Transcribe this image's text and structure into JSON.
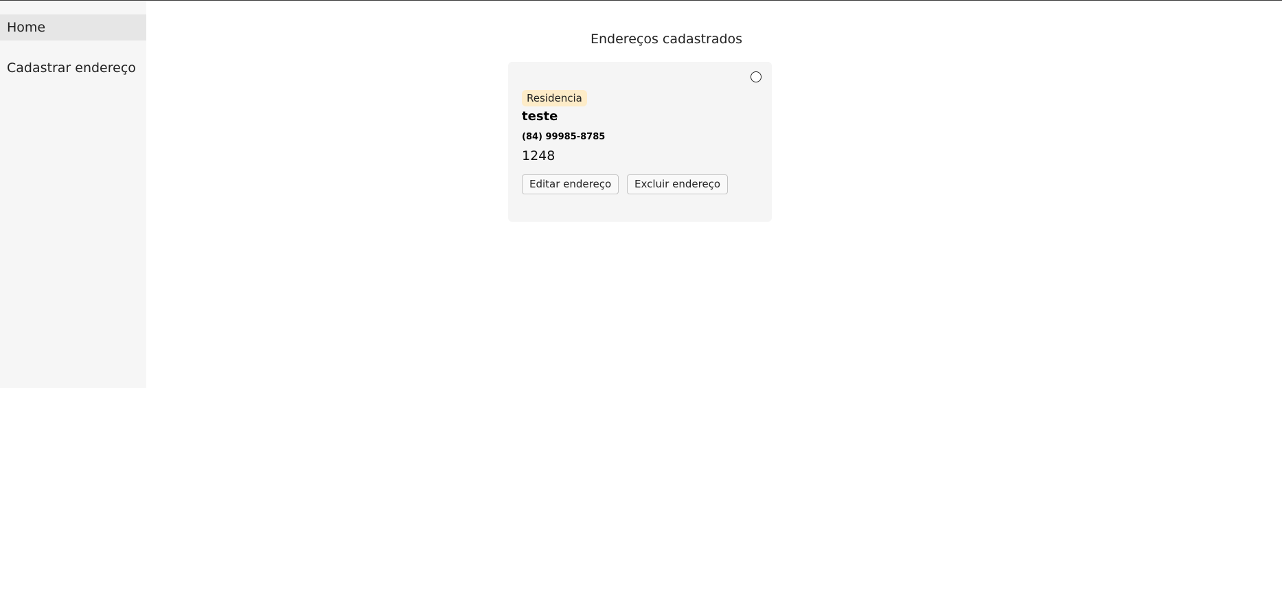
{
  "sidebar": {
    "items": [
      {
        "label": "Home",
        "active": true
      },
      {
        "label": "Cadastrar endereço",
        "active": false
      }
    ]
  },
  "main": {
    "title": "Endereços cadastrados",
    "addresses": [
      {
        "type_badge": "Residencia",
        "name": "teste",
        "phone": "(84) 99985-8785",
        "number": "1248",
        "selected": false,
        "edit_label": "Editar endereço",
        "delete_label": "Excluir endereço"
      }
    ]
  },
  "colors": {
    "sidebar_bg": "#f6f6f6",
    "sidebar_active_bg": "#e6e6e6",
    "card_bg": "#f5f5f5",
    "badge_bg": "#fdecc8"
  }
}
